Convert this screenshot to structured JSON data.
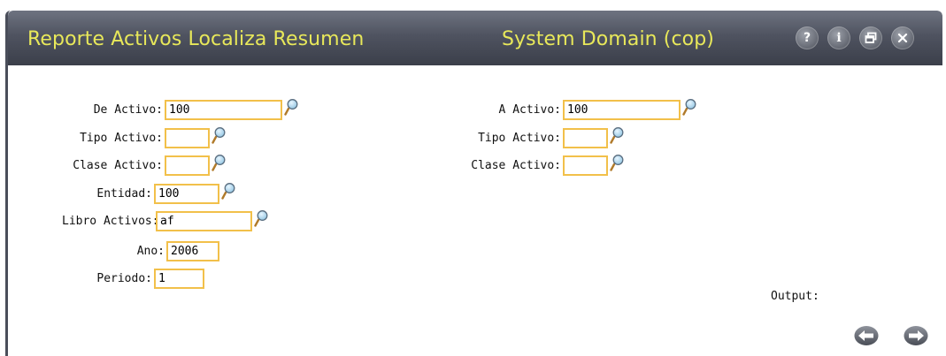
{
  "window": {
    "title": "Reporte Activos Localiza Resumen",
    "domain": "System Domain (cop)",
    "buttons": {
      "help": "?",
      "info": "i"
    }
  },
  "form": {
    "left": {
      "de_activo": {
        "label": "De Activo:",
        "value": "100"
      },
      "tipo_activo": {
        "label": "Tipo Activo:",
        "value": ""
      },
      "clase_activo": {
        "label": "Clase Activo:",
        "value": ""
      },
      "entidad": {
        "label": "Entidad:",
        "value": "100"
      },
      "libro_activos": {
        "label": "Libro Activos:",
        "value": "af"
      },
      "ano": {
        "label": "Ano:",
        "value": "2006"
      },
      "periodo": {
        "label": "Periodo:",
        "value": "1"
      }
    },
    "right": {
      "a_activo": {
        "label": "A Activo:",
        "value": "100"
      },
      "tipo_activo": {
        "label": "Tipo Activo:",
        "value": ""
      },
      "clase_activo": {
        "label": "Clase Activo:",
        "value": ""
      }
    },
    "output_label": "Output:"
  },
  "colors": {
    "title_text": "#e8e85a",
    "titlebar": "#4f5360",
    "field_border": "#f2c04a"
  },
  "icons": [
    "help-icon",
    "info-icon",
    "restore-icon",
    "close-icon",
    "magnifier-icon",
    "back-arrow-icon",
    "forward-arrow-icon"
  ]
}
